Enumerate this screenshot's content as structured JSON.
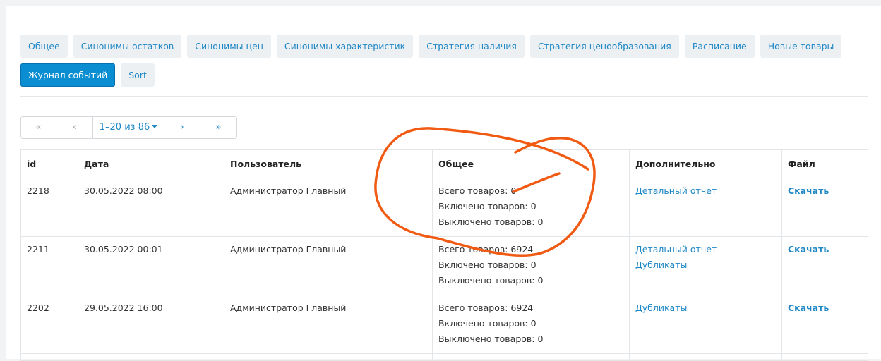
{
  "tabs": {
    "row1": [
      "Общее",
      "Синонимы остатков",
      "Синонимы цен",
      "Синонимы характеристик",
      "Стратегия наличия",
      "Стратегия ценообразования",
      "Расписание",
      "Новые товары"
    ],
    "row2": [
      "Журнал событий",
      "Sort"
    ],
    "active": "Журнал событий"
  },
  "pagination": {
    "first": "«",
    "prev": "‹",
    "range_label": "1–20 из 86",
    "next": "›",
    "last": "»"
  },
  "table": {
    "columns": [
      "id",
      "Дата",
      "Пользователь",
      "Общее",
      "Дополнительно",
      "Файл"
    ],
    "rows": [
      {
        "id": "2218",
        "date": "30.05.2022 08:00",
        "user": "Администратор Главный",
        "summary": [
          "Всего товаров: 0",
          "Включено товаров: 0",
          "Выключено товаров: 0"
        ],
        "extra": [
          "Детальный отчет"
        ],
        "file": "Скачать"
      },
      {
        "id": "2211",
        "date": "30.05.2022 00:01",
        "user": "Администратор Главный",
        "summary": [
          "Всего товаров: 6924",
          "Включено товаров: 0",
          "Выключено товаров: 0"
        ],
        "extra": [
          "Детальный отчет",
          "Дубликаты"
        ],
        "file": "Скачать"
      },
      {
        "id": "2202",
        "date": "29.05.2022 16:00",
        "user": "Администратор Главный",
        "summary": [
          "Всего товаров: 6924",
          "Включено товаров: 0",
          "Выключено товаров: 0"
        ],
        "extra": [
          "Дубликаты"
        ],
        "file": "Скачать"
      }
    ]
  },
  "colors": {
    "accent": "#1e87c6",
    "active_tab": "#0b8dd2",
    "annotation": "#f15a13"
  }
}
